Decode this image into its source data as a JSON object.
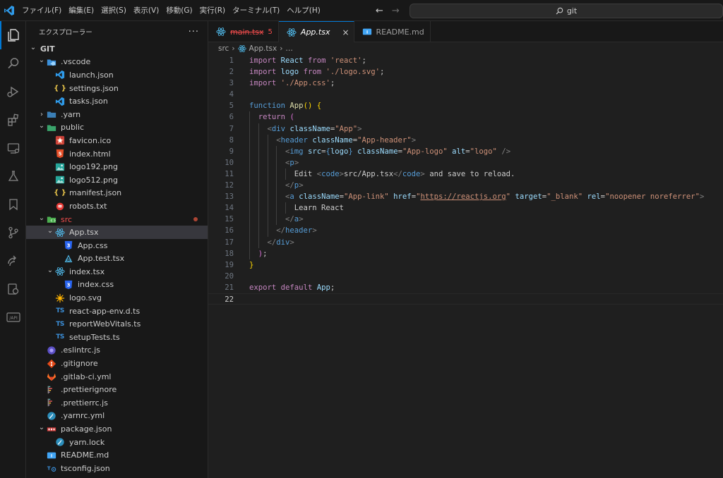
{
  "titlebar": {
    "menus": [
      "ファイル(F)",
      "編集(E)",
      "選択(S)",
      "表示(V)",
      "移動(G)",
      "実行(R)",
      "ターミナル(T)",
      "ヘルプ(H)"
    ],
    "search_text": "git"
  },
  "sidebar": {
    "title": "エクスプローラー",
    "root": "GIT",
    "items": [
      {
        "label": "GIT",
        "level": 0,
        "chevron": "down",
        "icon": "none",
        "bold": true
      },
      {
        "label": ".vscode",
        "level": 1,
        "chevron": "down",
        "icon": "vscode-folder-icon"
      },
      {
        "label": "launch.json",
        "level": 2,
        "icon": "vscode-file-icon"
      },
      {
        "label": "settings.json",
        "level": 2,
        "icon": "json-file-icon"
      },
      {
        "label": "tasks.json",
        "level": 2,
        "icon": "vscode-file-icon"
      },
      {
        "label": ".yarn",
        "level": 1,
        "chevron": "right",
        "icon": "yarn-folder-icon"
      },
      {
        "label": "public",
        "level": 1,
        "chevron": "down",
        "icon": "public-folder-icon"
      },
      {
        "label": "favicon.ico",
        "level": 2,
        "icon": "favicon-icon"
      },
      {
        "label": "index.html",
        "level": 2,
        "icon": "html-file-icon"
      },
      {
        "label": "logo192.png",
        "level": 2,
        "icon": "image-file-icon"
      },
      {
        "label": "logo512.png",
        "level": 2,
        "icon": "image-file-icon"
      },
      {
        "label": "manifest.json",
        "level": 2,
        "icon": "json-file-icon"
      },
      {
        "label": "robots.txt",
        "level": 2,
        "icon": "robots-file-icon"
      },
      {
        "label": "src",
        "level": 1,
        "chevron": "down",
        "icon": "src-folder-icon",
        "red": true,
        "modified": true
      },
      {
        "label": "App.tsx",
        "level": 2,
        "chevron": "down",
        "icon": "react-file-icon",
        "selected": true
      },
      {
        "label": "App.css",
        "level": 3,
        "icon": "css-file-icon"
      },
      {
        "label": "App.test.tsx",
        "level": 3,
        "icon": "test-file-icon"
      },
      {
        "label": "index.tsx",
        "level": 2,
        "chevron": "down",
        "icon": "react-file-icon"
      },
      {
        "label": "index.css",
        "level": 3,
        "icon": "css-file-icon"
      },
      {
        "label": "logo.svg",
        "level": 2,
        "icon": "svg-file-icon"
      },
      {
        "label": "react-app-env.d.ts",
        "level": 2,
        "icon": "ts-file-icon"
      },
      {
        "label": "reportWebVitals.ts",
        "level": 2,
        "icon": "ts-file-icon"
      },
      {
        "label": "setupTests.ts",
        "level": 2,
        "icon": "ts-file-icon"
      },
      {
        "label": ".eslintrc.js",
        "level": 1,
        "icon": "eslint-file-icon"
      },
      {
        "label": ".gitignore",
        "level": 1,
        "icon": "git-file-icon"
      },
      {
        "label": ".gitlab-ci.yml",
        "level": 1,
        "icon": "gitlab-file-icon"
      },
      {
        "label": ".prettierignore",
        "level": 1,
        "icon": "prettier-file-icon"
      },
      {
        "label": ".prettierrc.js",
        "level": 1,
        "icon": "prettier-file-icon"
      },
      {
        "label": ".yarnrc.yml",
        "level": 1,
        "icon": "yarn-file-icon"
      },
      {
        "label": "package.json",
        "level": 1,
        "chevron": "down",
        "icon": "npm-file-icon"
      },
      {
        "label": "yarn.lock",
        "level": 2,
        "icon": "yarn-file-icon"
      },
      {
        "label": "README.md",
        "level": 1,
        "icon": "readme-file-icon"
      },
      {
        "label": "tsconfig.json",
        "level": 1,
        "icon": "tsconfig-file-icon"
      }
    ]
  },
  "tabs": [
    {
      "label": "main.tsx",
      "badge": "5",
      "style": "error",
      "icon": "react-file-icon"
    },
    {
      "label": "App.tsx",
      "style": "active",
      "icon": "react-file-icon",
      "close": "×"
    },
    {
      "label": "README.md",
      "style": "normal",
      "icon": "readme-file-icon"
    }
  ],
  "breadcrumb": {
    "folder": "src",
    "file": "App.tsx",
    "tail": "…"
  },
  "editor": {
    "current_line": 22,
    "lines": [
      [
        [
          "kw",
          "import"
        ],
        [
          "tx",
          " "
        ],
        [
          "id",
          "React"
        ],
        [
          "tx",
          " "
        ],
        [
          "kw",
          "from"
        ],
        [
          "tx",
          " "
        ],
        [
          "st",
          "'react'"
        ],
        [
          "tx",
          ";"
        ]
      ],
      [
        [
          "kw",
          "import"
        ],
        [
          "tx",
          " "
        ],
        [
          "id",
          "logo"
        ],
        [
          "tx",
          " "
        ],
        [
          "kw",
          "from"
        ],
        [
          "tx",
          " "
        ],
        [
          "st",
          "'./logo.svg'"
        ],
        [
          "tx",
          ";"
        ]
      ],
      [
        [
          "kw",
          "import"
        ],
        [
          "tx",
          " "
        ],
        [
          "st",
          "'./App.css'"
        ],
        [
          "tx",
          ";"
        ]
      ],
      [],
      [
        [
          "kb",
          "function"
        ],
        [
          "tx",
          " "
        ],
        [
          "fn",
          "App"
        ],
        [
          "br",
          "()"
        ],
        [
          "tx",
          " "
        ],
        [
          "br",
          "{"
        ]
      ],
      [
        [
          "tx",
          "  "
        ],
        [
          "kw",
          "return"
        ],
        [
          "tx",
          " "
        ],
        [
          "bp",
          "("
        ]
      ],
      [
        [
          "tx",
          "    "
        ],
        [
          "pu",
          "<"
        ],
        [
          "tg",
          "div"
        ],
        [
          "tx",
          " "
        ],
        [
          "at",
          "className"
        ],
        [
          "tx",
          "="
        ],
        [
          "st",
          "\"App\""
        ],
        [
          "pu",
          ">"
        ]
      ],
      [
        [
          "tx",
          "      "
        ],
        [
          "pu",
          "<"
        ],
        [
          "tg",
          "header"
        ],
        [
          "tx",
          " "
        ],
        [
          "at",
          "className"
        ],
        [
          "tx",
          "="
        ],
        [
          "st",
          "\"App-header\""
        ],
        [
          "pu",
          ">"
        ]
      ],
      [
        [
          "tx",
          "        "
        ],
        [
          "pu",
          "<"
        ],
        [
          "tg",
          "img"
        ],
        [
          "tx",
          " "
        ],
        [
          "at",
          "src"
        ],
        [
          "tx",
          "="
        ],
        [
          "kb",
          "{"
        ],
        [
          "id",
          "logo"
        ],
        [
          "kb",
          "}"
        ],
        [
          "tx",
          " "
        ],
        [
          "at",
          "className"
        ],
        [
          "tx",
          "="
        ],
        [
          "st",
          "\"App-logo\""
        ],
        [
          "tx",
          " "
        ],
        [
          "at",
          "alt"
        ],
        [
          "tx",
          "="
        ],
        [
          "st",
          "\"logo\""
        ],
        [
          "tx",
          " "
        ],
        [
          "pu",
          "/>"
        ]
      ],
      [
        [
          "tx",
          "        "
        ],
        [
          "pu",
          "<"
        ],
        [
          "tg",
          "p"
        ],
        [
          "pu",
          ">"
        ]
      ],
      [
        [
          "tx",
          "          Edit "
        ],
        [
          "pu",
          "<"
        ],
        [
          "tg",
          "code"
        ],
        [
          "pu",
          ">"
        ],
        [
          "tx",
          "src/App.tsx"
        ],
        [
          "pu",
          "</"
        ],
        [
          "tg",
          "code"
        ],
        [
          "pu",
          ">"
        ],
        [
          "tx",
          " and save to reload."
        ]
      ],
      [
        [
          "tx",
          "        "
        ],
        [
          "pu",
          "</"
        ],
        [
          "tg",
          "p"
        ],
        [
          "pu",
          ">"
        ]
      ],
      [
        [
          "tx",
          "        "
        ],
        [
          "pu",
          "<"
        ],
        [
          "tg",
          "a"
        ],
        [
          "tx",
          " "
        ],
        [
          "at",
          "className"
        ],
        [
          "tx",
          "="
        ],
        [
          "st",
          "\"App-link\""
        ],
        [
          "tx",
          " "
        ],
        [
          "at",
          "href"
        ],
        [
          "tx",
          "="
        ],
        [
          "st",
          "\""
        ],
        [
          "stu",
          "https://reactjs.org"
        ],
        [
          "st",
          "\""
        ],
        [
          "tx",
          " "
        ],
        [
          "at",
          "target"
        ],
        [
          "tx",
          "="
        ],
        [
          "st",
          "\"_blank\""
        ],
        [
          "tx",
          " "
        ],
        [
          "at",
          "rel"
        ],
        [
          "tx",
          "="
        ],
        [
          "st",
          "\"noopener noreferrer\""
        ],
        [
          "pu",
          ">"
        ]
      ],
      [
        [
          "tx",
          "          Learn React"
        ]
      ],
      [
        [
          "tx",
          "        "
        ],
        [
          "pu",
          "</"
        ],
        [
          "tg",
          "a"
        ],
        [
          "pu",
          ">"
        ]
      ],
      [
        [
          "tx",
          "      "
        ],
        [
          "pu",
          "</"
        ],
        [
          "tg",
          "header"
        ],
        [
          "pu",
          ">"
        ]
      ],
      [
        [
          "tx",
          "    "
        ],
        [
          "pu",
          "</"
        ],
        [
          "tg",
          "div"
        ],
        [
          "pu",
          ">"
        ]
      ],
      [
        [
          "tx",
          "  "
        ],
        [
          "bp",
          ")"
        ],
        [
          "tx",
          ";"
        ]
      ],
      [
        [
          "br",
          "}"
        ]
      ],
      [],
      [
        [
          "kw",
          "export"
        ],
        [
          "tx",
          " "
        ],
        [
          "kw",
          "default"
        ],
        [
          "tx",
          " "
        ],
        [
          "id",
          "App"
        ],
        [
          "tx",
          ";"
        ]
      ],
      []
    ]
  },
  "colors": {
    "accent": "#0078d4",
    "error": "#f14c4c",
    "selection": "#37373d"
  }
}
